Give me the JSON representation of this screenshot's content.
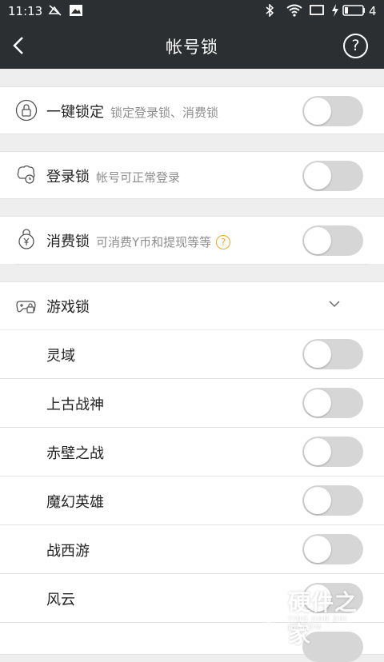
{
  "status_bar": {
    "time": "11:13",
    "battery_level": "4"
  },
  "header": {
    "title": "帐号锁",
    "help_label": "?"
  },
  "one_key_lock": {
    "label": "一键锁定",
    "desc": "锁定登录锁、消费锁",
    "enabled": false
  },
  "login_lock": {
    "label": "登录锁",
    "desc": "帐号可正常登录",
    "enabled": false
  },
  "pay_lock": {
    "label": "消费锁",
    "desc": "可消费Y币和提现等等",
    "hint": "?",
    "enabled": false
  },
  "game_lock": {
    "label": "游戏锁",
    "expanded": true,
    "games": [
      {
        "name": "灵域",
        "enabled": false
      },
      {
        "name": "上古战神",
        "enabled": false
      },
      {
        "name": "赤壁之战",
        "enabled": false
      },
      {
        "name": "魔幻英雄",
        "enabled": false
      },
      {
        "name": "战西游",
        "enabled": false
      },
      {
        "name": "风云",
        "enabled": false
      }
    ]
  },
  "watermark": {
    "main": "硬件之家",
    "sub": "YING JIAN ZHI JIA.COM"
  },
  "colors": {
    "bar": "#2c2f31",
    "background": "#eeeeee",
    "toggle_off": "#d6d6d6",
    "hint": "#f3a623"
  }
}
